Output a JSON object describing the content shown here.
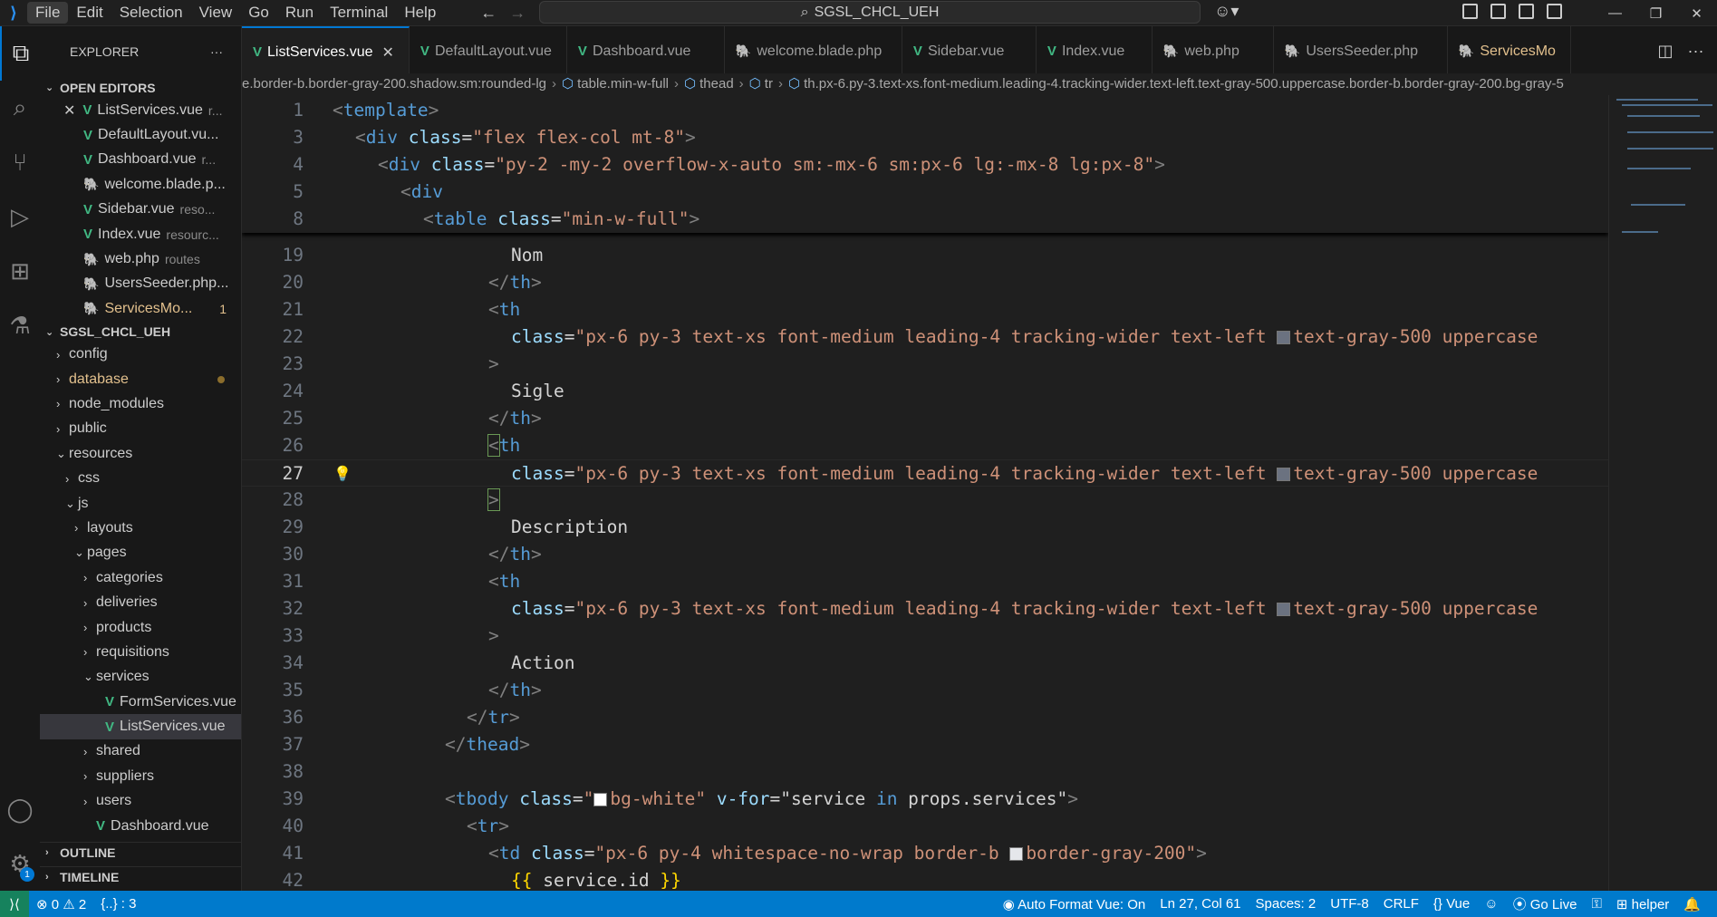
{
  "menu": [
    "File",
    "Edit",
    "Selection",
    "View",
    "Go",
    "Run",
    "Terminal",
    "Help"
  ],
  "search": {
    "text": "SGSL_CHCL_UEH"
  },
  "explorer": {
    "title": "EXPLORER",
    "more": "···"
  },
  "open_editors": {
    "title": "OPEN EDITORS",
    "items": [
      {
        "name": "ListServices.vue",
        "sub": "r..."
      },
      {
        "name": "DefaultLayout.vu...",
        "sub": ""
      },
      {
        "name": "Dashboard.vue",
        "sub": "r..."
      },
      {
        "name": "welcome.blade.p...",
        "sub": ""
      },
      {
        "name": "Sidebar.vue",
        "sub": "reso..."
      },
      {
        "name": "Index.vue",
        "sub": "resourc..."
      },
      {
        "name": "web.php",
        "sub": "routes"
      },
      {
        "name": "UsersSeeder.php...",
        "sub": ""
      },
      {
        "name": "ServicesMo...",
        "sub": "",
        "count": "1"
      }
    ]
  },
  "project": {
    "title": "SGSL_CHCL_UEH",
    "tree": [
      "config",
      "database",
      "node_modules",
      "public",
      "resources",
      "css",
      "js",
      "layouts",
      "pages",
      "categories",
      "deliveries",
      "products",
      "requisitions",
      "services",
      "FormServices.vue",
      "ListServices.vue",
      "shared",
      "suppliers",
      "users",
      "Dashboard.vue"
    ]
  },
  "outline": "OUTLINE",
  "timeline": "TIMELINE",
  "tabs": [
    "ListServices.vue",
    "DefaultLayout.vue",
    "Dashboard.vue",
    "welcome.blade.php",
    "Sidebar.vue",
    "Index.vue",
    "web.php",
    "UsersSeeder.php",
    "ServicesMo"
  ],
  "breadcrumbs": {
    "b0": "e.border-b.border-gray-200.shadow.sm:rounded-lg",
    "b1": "table.min-w-full",
    "b2": "thead",
    "b3": "tr",
    "b4": "th.px-6.py-3.text-xs.font-medium.leading-4.tracking-wider.text-left.text-gray-500.uppercase.border-b.border-gray-200.bg-gray-5"
  },
  "code": {
    "ln1": "1",
    "ln3": "3",
    "ln4": "4",
    "ln5": "5",
    "ln8": "8",
    "template": "template",
    "div": "div",
    "table": "table",
    "class_attr": "class",
    "s3": "\"flex flex-col mt-8\"",
    "s4": "\"py-2 -my-2 overflow-x-auto sm:-mx-6 sm:px-6 lg:-mx-8 lg:px-8\"",
    "s8": "\"min-w-full\"",
    "lines": [
      "19",
      "20",
      "21",
      "22",
      "23",
      "24",
      "25",
      "26",
      "27",
      "28",
      "29",
      "30",
      "31",
      "32",
      "33",
      "34",
      "35",
      "36",
      "37",
      "38",
      "39",
      "40",
      "41",
      "42"
    ],
    "nom": "Nom",
    "sigle": "Sigle",
    "description": "Description",
    "action": "Action",
    "th": "th",
    "tr": "tr",
    "thead": "thead",
    "tbody": "tbody",
    "td": "td",
    "th_class_a": "\"px-6 py-3 text-xs font-medium leading-4 tracking-wider text-left ",
    "th_class_b": "text-gray-500 uppercase",
    "tbody_class": "bg-white",
    "vfor_attr": "v-for",
    "vfor_a": "\"service ",
    "vfor_in": "in",
    "vfor_b": " props.services\"",
    "td_class_a": "\"px-6 py-4 whitespace-no-wrap border-b ",
    "td_class_b": "border-gray-200\"",
    "service_id": " service.id "
  },
  "status": {
    "errors": "0",
    "warnings": "2",
    "brackets": "{..} : 3",
    "auto_format": "Auto Format Vue: On",
    "position": "Ln 27, Col 61",
    "spaces": "Spaces: 2",
    "encoding": "UTF-8",
    "eol": "CRLF",
    "language": "Vue",
    "go_live": "Go Live",
    "helper": "helper"
  },
  "colors": {
    "accent": "#0078d4",
    "status_bar": "#007acc",
    "vue": "#41b883",
    "php": "#a074c4"
  }
}
